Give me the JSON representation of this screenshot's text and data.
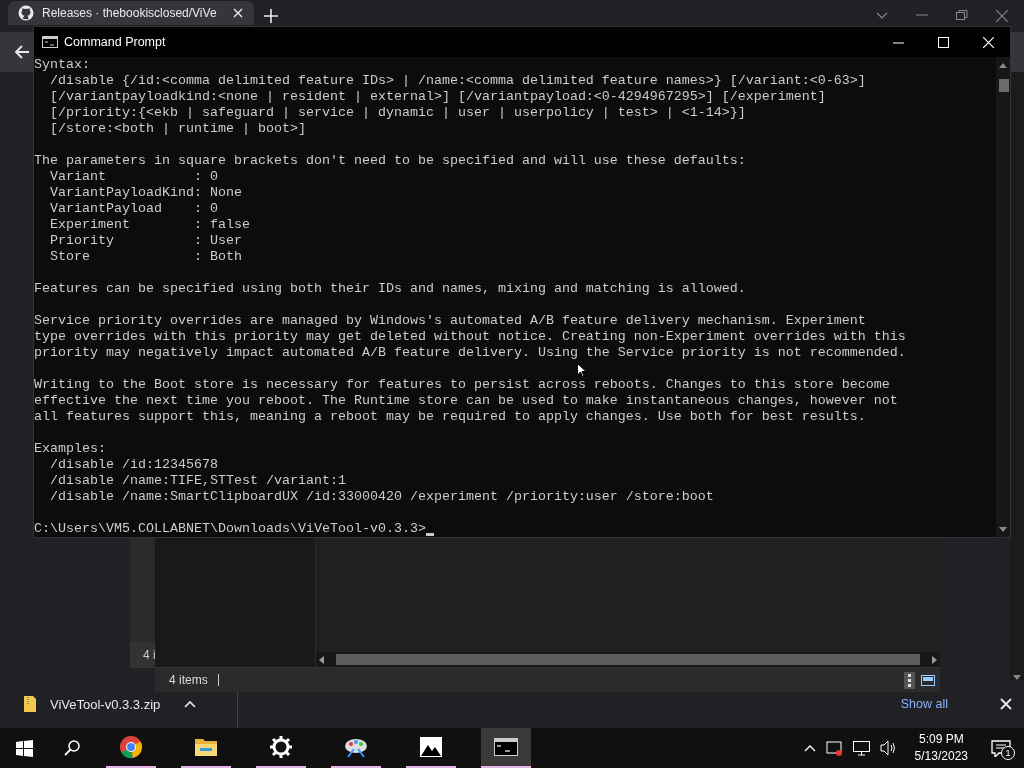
{
  "browser": {
    "tab": {
      "title": "Releases · thebookisclosed/ViVe"
    }
  },
  "command_prompt": {
    "title": "Command Prompt",
    "blocks": [
      [
        "Syntax:",
        "  /disable {/id:<comma delimited feature IDs> | /name:<comma delimited feature names>} [/variant:<0-63>]",
        "  [/variantpayloadkind:<none | resident | external>] [/variantpayload:<0-4294967295>] [/experiment]",
        "  [/priority:{<ekb | safeguard | service | dynamic | user | userpolicy | test> | <1-14>}]",
        "  [/store:<both | runtime | boot>]"
      ],
      [
        "The parameters in square brackets don't need to be specified and will use these defaults:",
        "  Variant           : 0",
        "  VariantPayloadKind: None",
        "  VariantPayload    : 0",
        "  Experiment        : false",
        "  Priority          : User",
        "  Store             : Both"
      ],
      [
        "Features can be specified using both their IDs and names, mixing and matching is allowed."
      ],
      [
        "Service priority overrides are managed by Windows's automated A/B feature delivery mechanism. Experiment",
        "type overrides with this priority may get deleted without notice. Creating non-Experiment overrides with this",
        "priority may negatively impact automated A/B feature delivery. Using the Service priority is not recommended."
      ],
      [
        "Writing to the Boot store is necessary for features to persist across reboots. Changes to this store become",
        "effective the next time you reboot. The Runtime store can be used to make instantaneous changes, however not",
        "all features support this, meaning a reboot may be required to apply changes. Use both for best results."
      ],
      [
        "Examples:",
        "  /disable /id:12345678",
        "  /disable /name:TIFE,STTest /variant:1",
        "  /disable /name:SmartClipboardUX /id:33000420 /experiment /priority:user /store:boot"
      ]
    ],
    "prompt": "C:\\Users\\VM5.COLLABNET\\Downloads\\ViVeTool-v0.3.3>"
  },
  "background_window": {
    "status": "4 i"
  },
  "file_explorer": {
    "status_bar": {
      "item_count": "4 items"
    }
  },
  "downloads_bar": {
    "file": "ViVeTool-v0.3.3.zip",
    "show_all": "Show all"
  },
  "taskbar": {
    "apps": [
      {
        "kind": "chrome",
        "selected": false
      },
      {
        "kind": "folder",
        "selected": false
      },
      {
        "kind": "gear",
        "selected": false
      },
      {
        "kind": "paint",
        "selected": false
      },
      {
        "kind": "photos",
        "selected": false
      },
      {
        "kind": "console",
        "selected": true
      }
    ],
    "time": "5:09 PM",
    "date": "5/13/2023",
    "notifications": "1"
  }
}
